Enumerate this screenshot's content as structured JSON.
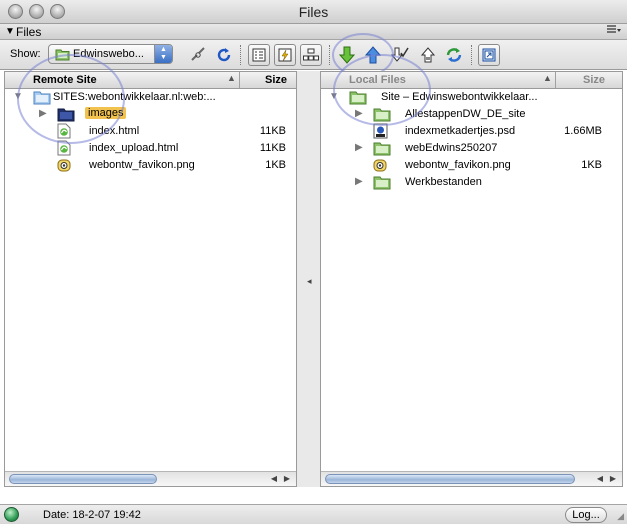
{
  "window": {
    "title": "Files"
  },
  "panel": {
    "title": "Files"
  },
  "toolbar": {
    "show_label": "Show:",
    "site_selected": "Edwinswebo..."
  },
  "remote": {
    "header_name": "Remote Site",
    "header_size": "Size",
    "items": [
      {
        "name": "SITES:webontwikkelaar.nl:web:...",
        "size": "",
        "icon": "folder-icon",
        "expand": "open"
      },
      {
        "name": "images",
        "size": "",
        "icon": "folder-dark-icon",
        "expand": "closed",
        "highlight": true
      },
      {
        "name": "index.html",
        "size": "11KB",
        "icon": "html-file-icon"
      },
      {
        "name": "index_upload.html",
        "size": "11KB",
        "icon": "html-file-icon"
      },
      {
        "name": "webontw_favikon.png",
        "size": "1KB",
        "icon": "image-file-icon"
      }
    ]
  },
  "local": {
    "header_name": "Local Files",
    "header_size": "Size",
    "items": [
      {
        "name": "Site – Edwinswebontwikkelaar...",
        "size": "",
        "icon": "site-folder-icon",
        "expand": "open"
      },
      {
        "name": "AllestappenDW_DE_site",
        "size": "",
        "icon": "folder-icon",
        "expand": "closed"
      },
      {
        "name": "indexmetkadertjes.psd",
        "size": "1.66MB",
        "icon": "psd-file-icon"
      },
      {
        "name": "webEdwins250207",
        "size": "",
        "icon": "folder-icon",
        "expand": "closed"
      },
      {
        "name": "webontw_favikon.png",
        "size": "1KB",
        "icon": "image-file-icon"
      },
      {
        "name": "Werkbestanden",
        "size": "",
        "icon": "folder-icon",
        "expand": "closed"
      }
    ]
  },
  "status": {
    "date": "Date: 18-2-07 19:42",
    "log_label": "Log..."
  },
  "colors": {
    "highlight": "#f2c24e",
    "accent_blue": "#3a6fc4",
    "folder_green": "#7ab648"
  }
}
